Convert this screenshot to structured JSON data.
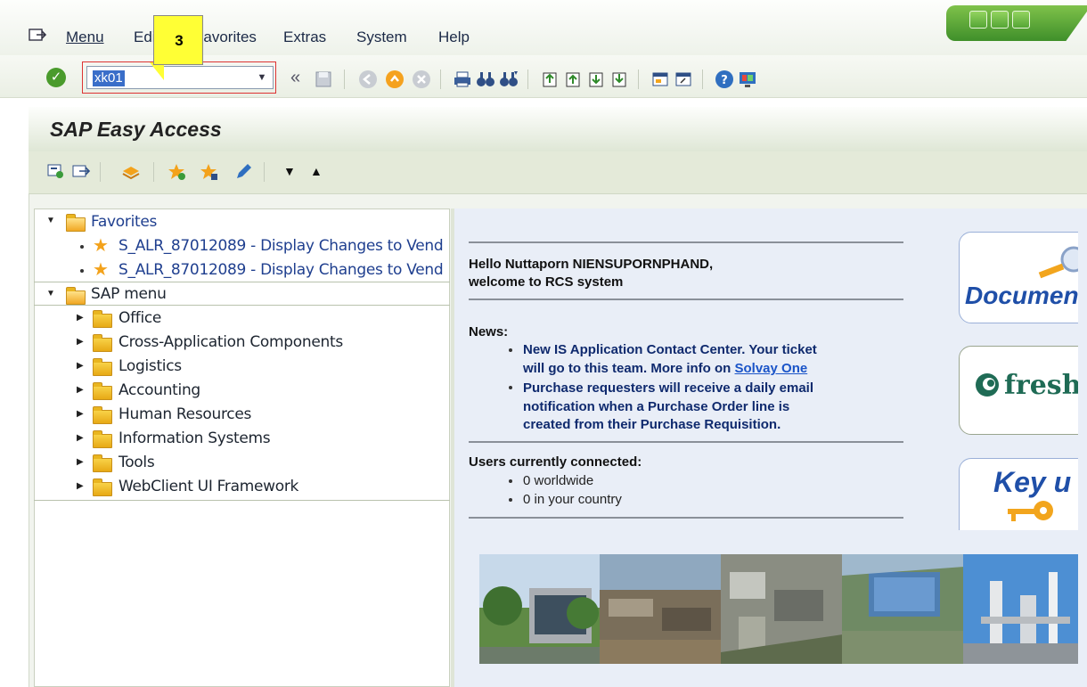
{
  "menu": {
    "items": [
      "Menu",
      "Edit",
      "Favorites",
      "Extras",
      "System",
      "Help"
    ]
  },
  "toolbar": {
    "command_value": "xk01",
    "callout_number": "3"
  },
  "easy_access": {
    "title": "SAP Easy Access"
  },
  "tree": {
    "favorites_label": "Favorites",
    "favorites": [
      "S_ALR_87012089 - Display Changes to Vend",
      "S_ALR_87012089 - Display Changes to Vend"
    ],
    "sap_menu_label": "SAP menu",
    "sap_menu_items": [
      "Office",
      "Cross-Application Components",
      "Logistics",
      "Accounting",
      "Human Resources",
      "Information Systems",
      "Tools",
      "WebClient UI Framework"
    ]
  },
  "welcome": {
    "greeting_line1": "Hello Nuttaporn NIENSUPORNPHAND,",
    "greeting_line2": "welcome to RCS system",
    "news_heading": "News:",
    "news_item1_line1": "New IS Application Contact Center. Your ticket",
    "news_item1_line2_prefix": "will go to this team. More info on",
    "news_item1_link": "Solvay One",
    "news_item2_line1": "Purchase requesters will receive a daily email",
    "news_item2_line2": "notification when a Purchase Order line is",
    "news_item2_line3": "created from their Purchase Requisition.",
    "users_heading": "Users currently connected:",
    "users_worldwide": "0 worldwide",
    "users_country": "0 in your country"
  },
  "tiles": {
    "documents": "Documen",
    "fresh": "fresh",
    "key_users": "Key u"
  },
  "colors": {
    "accent_green": "#4a9b2c",
    "highlight_red": "#dd3333",
    "link_blue": "#1a54c8"
  }
}
